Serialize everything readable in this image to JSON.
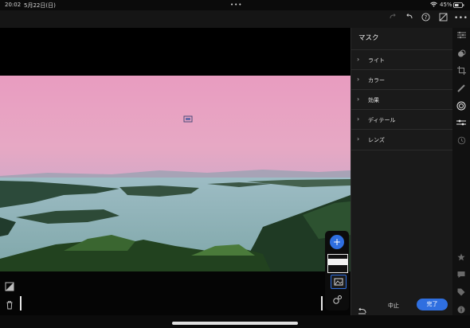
{
  "status": {
    "time": "20:02",
    "date": "5月22日(日)",
    "dots": "•••",
    "battery": "45%"
  },
  "toolbar": {
    "more": "•••"
  },
  "panel": {
    "title": "マスク",
    "sections": [
      {
        "label": "ライト"
      },
      {
        "label": "カラー"
      },
      {
        "label": "効果"
      },
      {
        "label": "ディテール"
      },
      {
        "label": "レンズ"
      }
    ]
  },
  "actions": {
    "cancel": "中止",
    "done": "完了",
    "add": "+"
  },
  "colors": {
    "accent": "#2f6fe0",
    "sky": "#e8a6c2",
    "water": "#8fb4b8"
  }
}
